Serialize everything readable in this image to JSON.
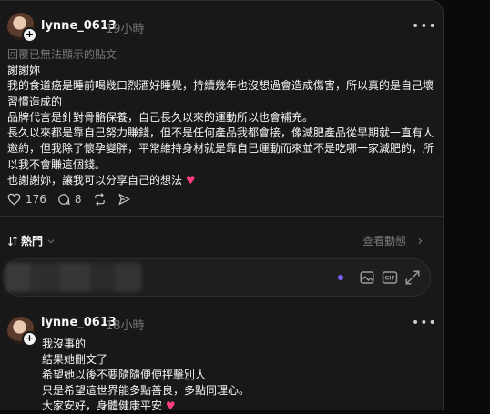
{
  "post": {
    "username": "lynne_0613",
    "time": "19小時",
    "note": "回覆已無法顯示的貼文",
    "lines": [
      "謝謝妳",
      "我的食道癌是睡前喝幾口烈酒好睡覺，持續幾年也沒想過會造成傷害，所以真的是自己壞習慣造成的",
      "品牌代言是針對骨骼保養，自己長久以來的運動所以也會補充。",
      "長久以來都是靠自己努力賺錢，但不是任何產品我都會接，像減肥產品從早期就一直有人邀約，但我除了懷孕變胖，平常維持身材就是靠自己運動而來並不是吃哪一家減肥的，所以我不會賺這個錢。",
      "也謝謝妳，讓我可以分享自己的想法"
    ],
    "likes": "176",
    "comments": "8"
  },
  "sort": {
    "label": "熱門",
    "activity": "查看動態"
  },
  "reply2": {
    "username": "lynne_0613",
    "time": "18小時",
    "lines": [
      "我沒事的",
      "結果她刪文了",
      "希望她以後不要隨隨便便抨擊別人",
      "只是希望這世界能多點善良，多點同理心。",
      "大家安好，身體健康平安"
    ]
  },
  "icons": [
    "avatar",
    "plus-icon",
    "more-icon",
    "heart-icon",
    "comment-icon",
    "repost-icon",
    "share-icon",
    "sort-icon",
    "chevron-down-icon",
    "chevron-right-icon",
    "image-icon",
    "gif-icon",
    "expand-icon"
  ],
  "colors": {
    "background": "#181818",
    "accent_dot": "#7b5cff",
    "heart": "#ff3d7f"
  }
}
